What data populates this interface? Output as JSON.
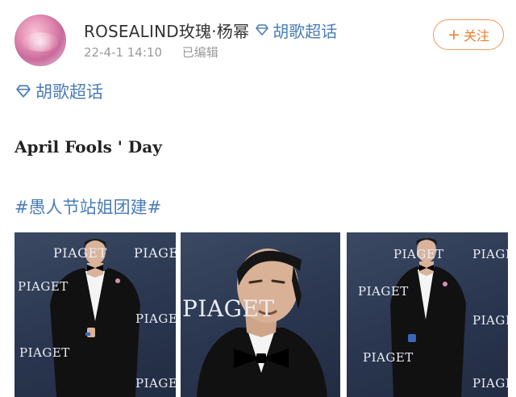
{
  "post": {
    "author_name": "ROSEALIND玫瑰·杨幂",
    "header_topic": "胡歌超话",
    "timestamp": "22-4-1 14:10",
    "edited_label": "已编辑",
    "follow_label": "关注",
    "topic_tag": "胡歌超话",
    "title": "April Fools ' Day",
    "hashtag": "#愚人节站姐团建#",
    "photo_brand": "PIAGET"
  },
  "colors": {
    "link_blue": "#4a7eb6",
    "follow_orange": "#ef7b2b",
    "meta_gray": "#9a9a9a",
    "backdrop_navy": "#2a3650"
  },
  "icons": {
    "topic": "diamond-icon",
    "follow": "plus-icon"
  }
}
